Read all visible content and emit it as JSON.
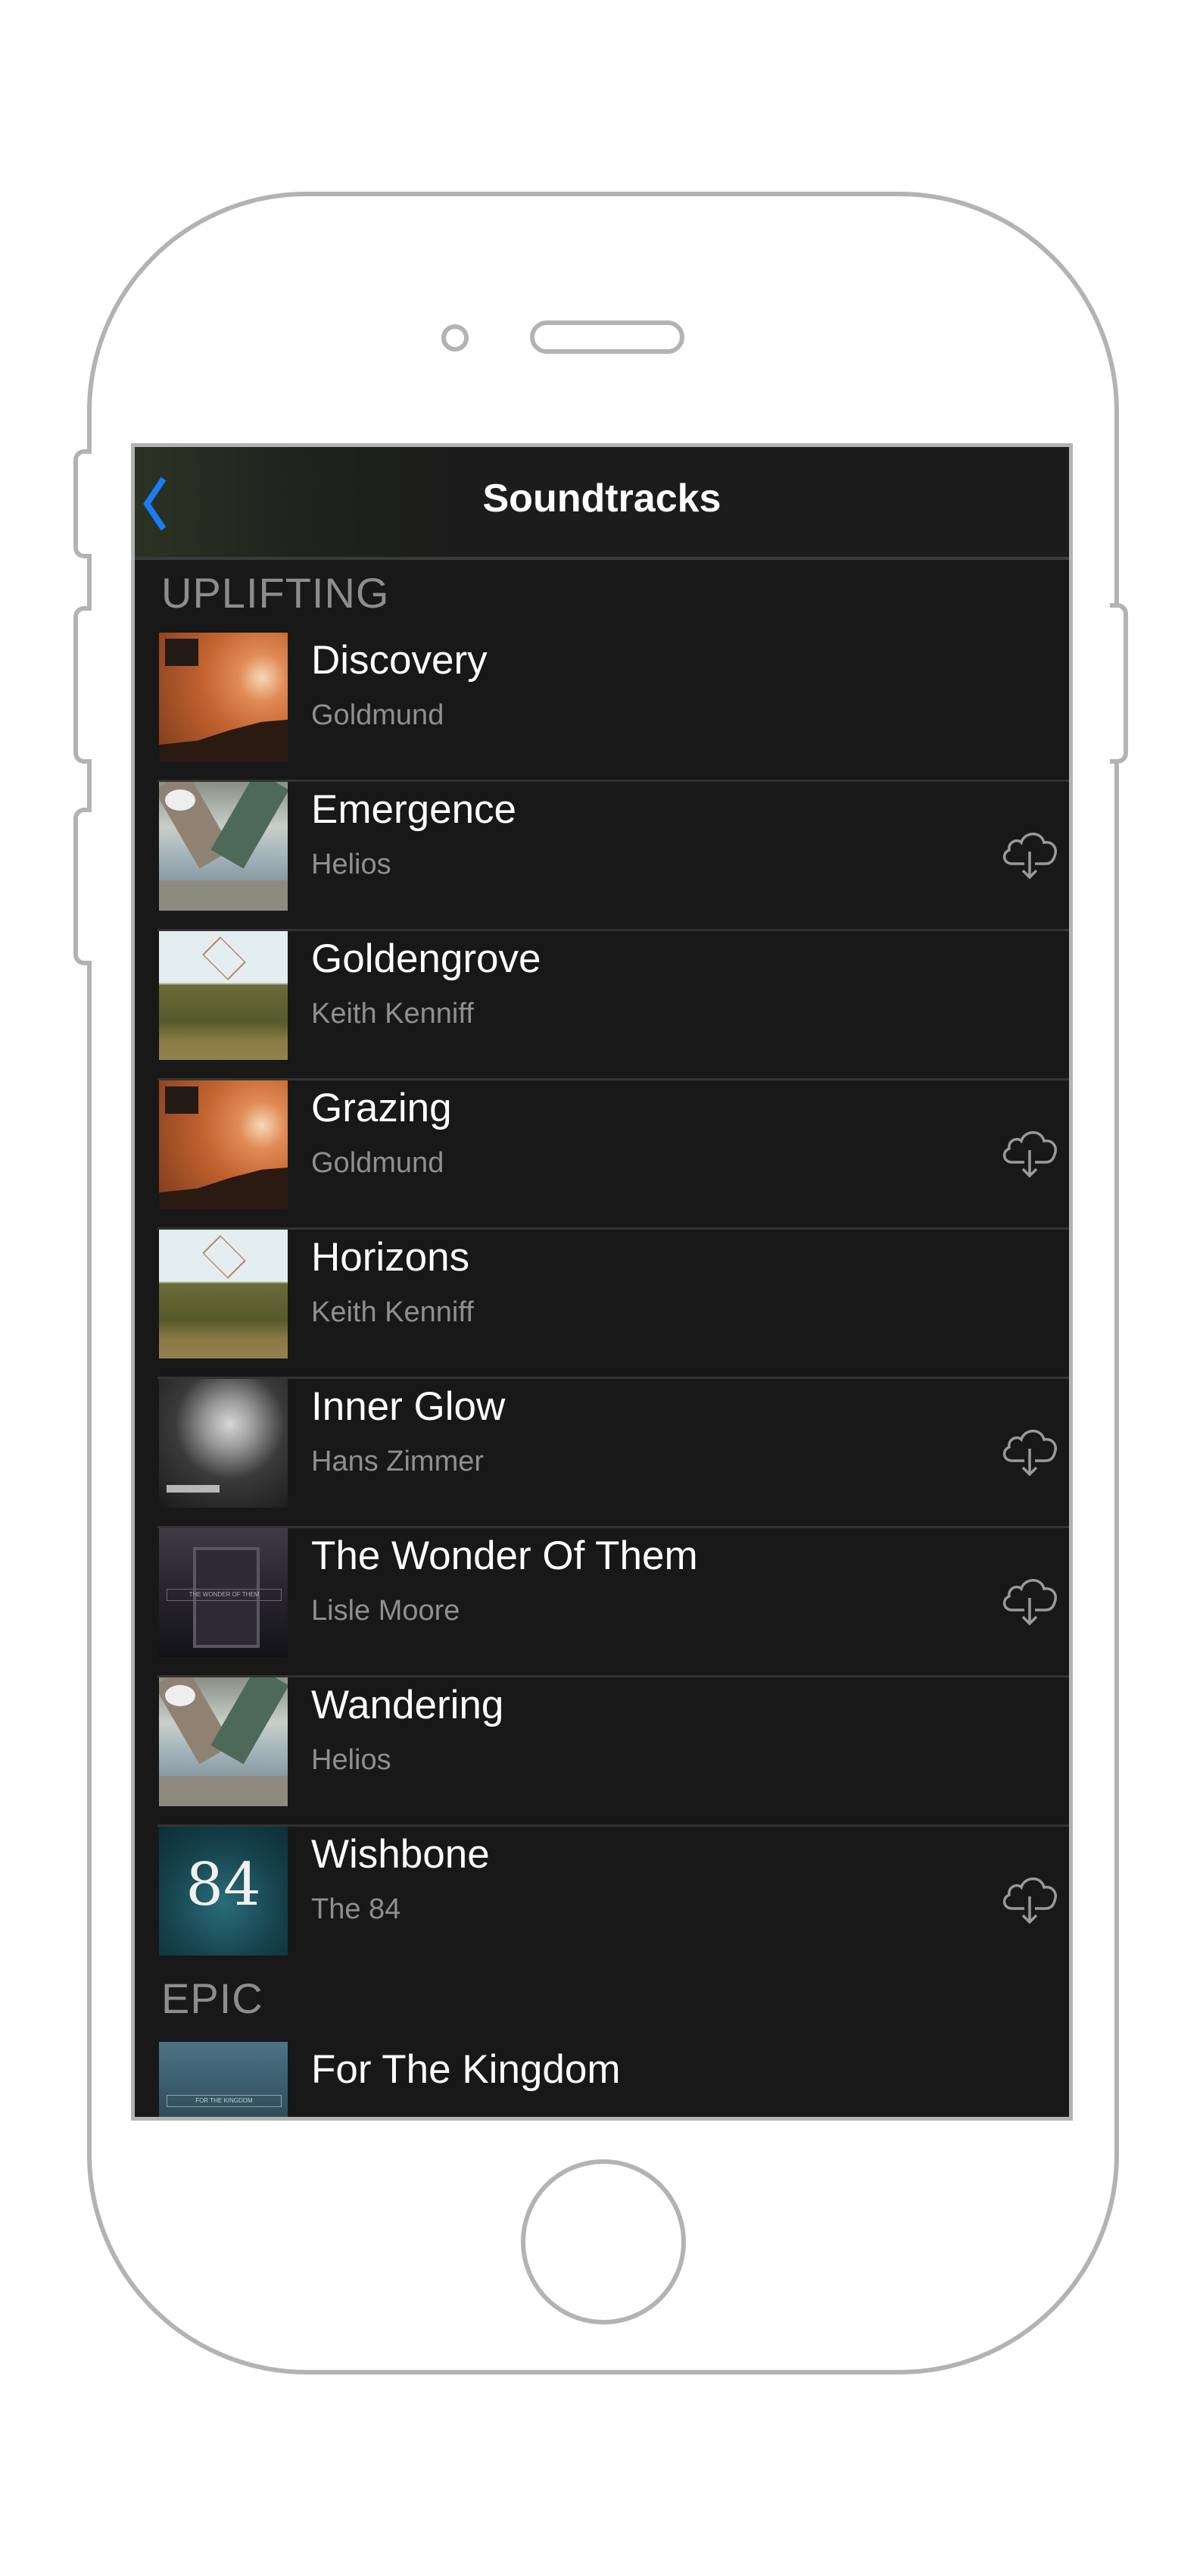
{
  "nav": {
    "title": "Soundtracks",
    "back_icon": "chevron-left-icon",
    "accent_color": "#1a7cf5"
  },
  "sections": [
    {
      "header": "UPLIFTING",
      "tracks": [
        {
          "title": "Discovery",
          "artist": "Goldmund",
          "artwork": "goldmund",
          "download_available": false
        },
        {
          "title": "Emergence",
          "artist": "Helios",
          "artwork": "helios",
          "download_available": true
        },
        {
          "title": "Goldengrove",
          "artist": "Keith Kenniff",
          "artwork": "kenniff",
          "download_available": false
        },
        {
          "title": "Grazing",
          "artist": "Goldmund",
          "artwork": "goldmund",
          "download_available": true
        },
        {
          "title": "Horizons",
          "artist": "Keith Kenniff",
          "artwork": "kenniff",
          "download_available": false
        },
        {
          "title": "Inner Glow",
          "artist": "Hans Zimmer",
          "artwork": "zimmer",
          "download_available": true
        },
        {
          "title": "The Wonder Of Them",
          "artist": "Lisle Moore",
          "artwork": "moore",
          "download_available": true
        },
        {
          "title": "Wandering",
          "artist": "Helios",
          "artwork": "helios",
          "download_available": false
        },
        {
          "title": "Wishbone",
          "artist": "The 84",
          "artwork": "84",
          "download_available": true
        }
      ]
    },
    {
      "header": "EPIC",
      "tracks": [
        {
          "title": "For The Kingdom",
          "artist": "",
          "artwork": "kingdom",
          "download_available": false
        }
      ]
    }
  ],
  "artwork_text": {
    "moore": "THE WONDER OF THEM",
    "84": "84",
    "kingdom": "FOR THE KINGDOM"
  },
  "icons": {
    "download": "cloud-download-icon"
  }
}
